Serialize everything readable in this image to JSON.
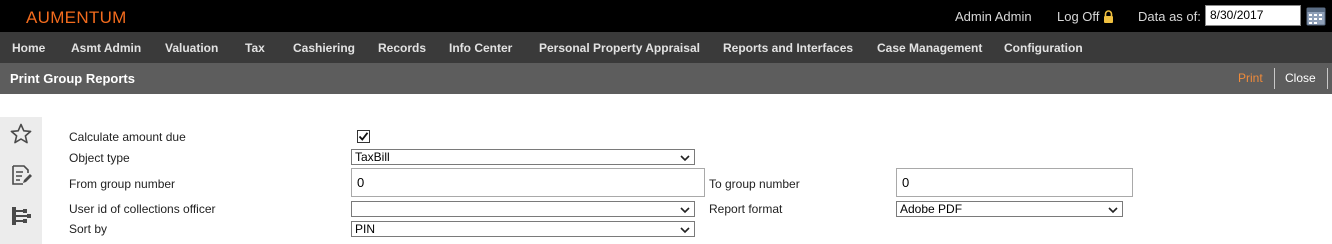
{
  "header": {
    "brand": "AUMENTUM",
    "user": "Admin Admin",
    "logoff": "Log Off",
    "data_as_of_label": "Data as of:",
    "data_as_of_value": "8/30/2017"
  },
  "nav": {
    "items": [
      "Home",
      "Asmt Admin",
      "Valuation",
      "Tax",
      "Cashiering",
      "Records",
      "Info Center",
      "Personal Property Appraisal",
      "Reports and Interfaces",
      "Case Management",
      "Configuration"
    ]
  },
  "titlebar": {
    "title": "Print Group Reports",
    "print": "Print",
    "close": "Close"
  },
  "form": {
    "calculate_amount_due": {
      "label": "Calculate amount due",
      "checked": true
    },
    "object_type": {
      "label": "Object type",
      "value": "TaxBill"
    },
    "from_group_number": {
      "label": "From group number",
      "value": "0"
    },
    "to_group_number": {
      "label": "To group number",
      "value": "0"
    },
    "collections_officer": {
      "label": "User id of collections officer",
      "value": ""
    },
    "report_format": {
      "label": "Report format",
      "value": "Adobe PDF"
    },
    "sort_by": {
      "label": "Sort by",
      "value": "PIN"
    }
  },
  "sidebar": {
    "icons": [
      "star-icon",
      "edit-document-icon",
      "hierarchy-icon"
    ]
  },
  "colors": {
    "brand": "#f26b1d",
    "print_link": "#f08b3a",
    "topbar": "#000000",
    "navbar": "#3a3a3a",
    "titlebar": "#5d5d5d"
  }
}
